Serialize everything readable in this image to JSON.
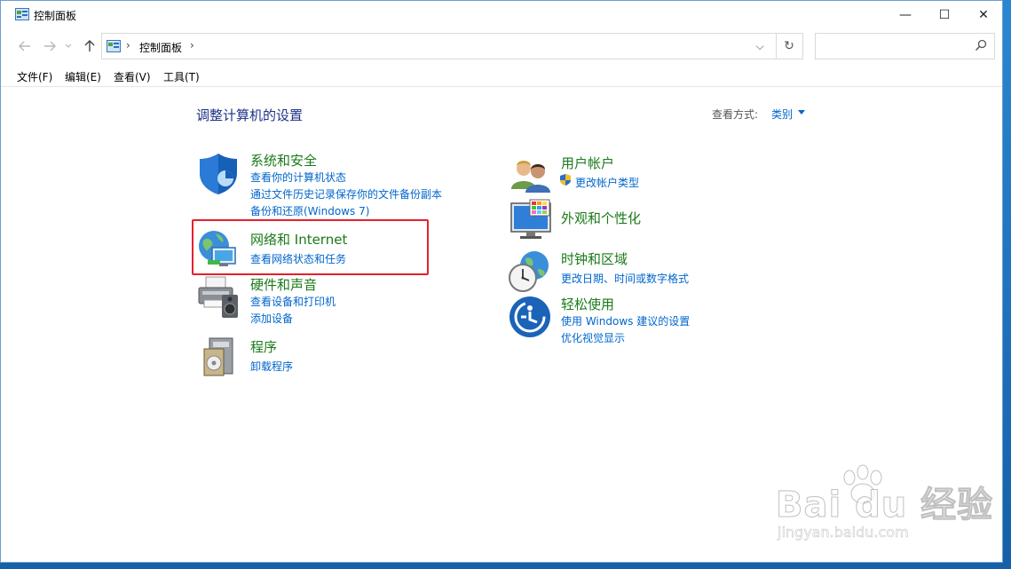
{
  "window": {
    "title": "控制面板",
    "controls": {
      "minimize": "—",
      "maximize": "☐",
      "close": "✕"
    }
  },
  "nav": {
    "back_icon": "back-arrow-icon",
    "forward_icon": "forward-arrow-icon",
    "recent_icon": "chevron-down-icon",
    "up_icon": "up-arrow-icon",
    "address": {
      "separator": "›",
      "path": "控制面板",
      "trailing_separator": "›"
    },
    "dropdown_glyph": "⌵",
    "refresh_glyph": "↻",
    "search": {
      "placeholder": ""
    }
  },
  "menu": [
    {
      "label": "文件(F)"
    },
    {
      "label": "编辑(E)"
    },
    {
      "label": "查看(V)"
    },
    {
      "label": "工具(T)"
    }
  ],
  "main": {
    "heading": "调整计算机的设置",
    "view_by": {
      "label": "查看方式:",
      "value": "类别"
    }
  },
  "categories": {
    "system": {
      "title": "系统和安全",
      "links": [
        "查看你的计算机状态",
        "通过文件历史记录保存你的文件备份副本",
        "备份和还原(Windows 7)"
      ]
    },
    "network": {
      "title": "网络和 Internet",
      "links": [
        "查看网络状态和任务"
      ]
    },
    "hardware": {
      "title": "硬件和声音",
      "links": [
        "查看设备和打印机",
        "添加设备"
      ]
    },
    "programs": {
      "title": "程序",
      "links": [
        "卸载程序"
      ]
    },
    "users": {
      "title": "用户帐户",
      "links": [
        "更改帐户类型"
      ]
    },
    "appearance": {
      "title": "外观和个性化",
      "links": []
    },
    "clock": {
      "title": "时钟和区域",
      "links": [
        "更改日期、时间或数字格式"
      ]
    },
    "ease": {
      "title": "轻松使用",
      "links": [
        "使用 Windows 建议的设置",
        "优化视觉显示"
      ]
    }
  },
  "watermark": {
    "text": "Bai du 经验",
    "url": "jingyan.baidu.com"
  },
  "colors": {
    "title_green": "#1a7a1a",
    "link_blue": "#0066cc",
    "heading_blue": "#1e3287",
    "highlight_red": "#e4212b"
  }
}
